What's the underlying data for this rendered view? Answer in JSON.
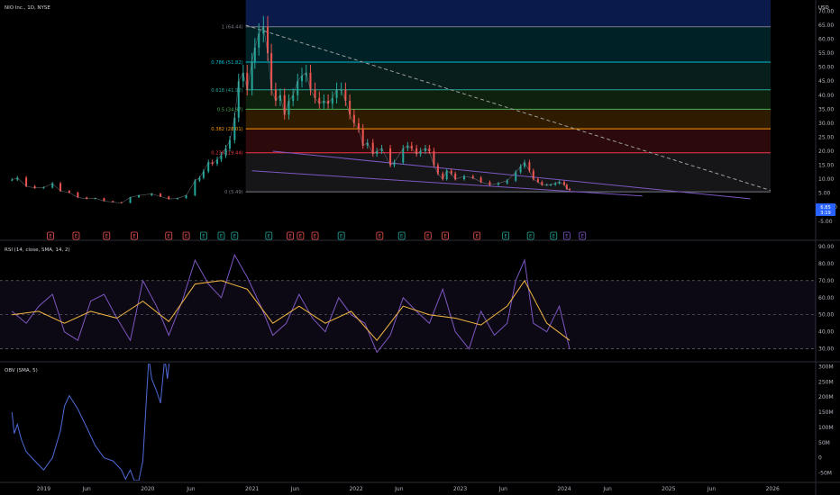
{
  "header": {
    "title": "NIO Inc., 1D, NYSE",
    "currency": "USD",
    "rsi_title": "RSI (14, close, SMA, 14, 2)",
    "obv_title": "OBV (SMA, 5)",
    "price_badge": "6.85",
    "price_badge_sub": "3:19"
  },
  "colors": {
    "background": "#000000",
    "candle_up": "#26a69a",
    "candle_down": "#ef5350",
    "trendline": "#7e57c2",
    "rsi_line": "#7e57c2",
    "rsi_ma": "#f5b942",
    "obv_line": "#4f6bd9",
    "dashed_line": "#9e9e9e",
    "badge": "#2962ff",
    "earnings_green": "#26a69a",
    "earnings_red": "#ef5350"
  },
  "chart_data": [
    {
      "type": "line",
      "panel": "price",
      "title": "NIO Inc., 1D, NYSE",
      "unit": "USD",
      "yticks": [
        -5,
        0,
        5,
        10,
        15,
        20,
        25,
        30,
        35,
        40,
        45,
        50,
        55,
        60,
        65,
        70
      ],
      "ytick_labels": [
        "-5.00",
        "0.0000",
        "5.00",
        "10.00",
        "15.00",
        "20.00",
        "25.00",
        "30.00",
        "35.00",
        "40.00",
        "45.00",
        "50.00",
        "55.00",
        "60.00",
        "65.00",
        "70.00"
      ],
      "ylim": [
        -7,
        74
      ],
      "xticks": [
        {
          "date": "2019-01-01",
          "label": "2019"
        },
        {
          "date": "2019-06-01",
          "label": "Jun"
        },
        {
          "date": "2020-01-01",
          "label": "2020"
        },
        {
          "date": "2020-06-01",
          "label": "Jun"
        },
        {
          "date": "2021-01-01",
          "label": "2021"
        },
        {
          "date": "2021-06-01",
          "label": "Jun"
        },
        {
          "date": "2022-01-01",
          "label": "2022"
        },
        {
          "date": "2022-06-01",
          "label": "Jun"
        },
        {
          "date": "2023-01-01",
          "label": "2023"
        },
        {
          "date": "2023-06-01",
          "label": "Jun"
        },
        {
          "date": "2024-01-01",
          "label": "2024"
        },
        {
          "date": "2024-06-01",
          "label": "Jun"
        },
        {
          "date": "2025-01-01",
          "label": "2025"
        },
        {
          "date": "2025-06-01",
          "label": "Jun"
        },
        {
          "date": "2026-01-01",
          "label": "2026"
        }
      ],
      "xlim": [
        "2018-08-01",
        "2026-06-01"
      ],
      "series": [
        {
          "x": [
            "2018-09-12",
            "2018-10-01",
            "2018-11-01",
            "2018-12-01",
            "2019-01-01",
            "2019-02-01",
            "2019-03-01",
            "2019-04-01",
            "2019-05-01",
            "2019-06-01",
            "2019-07-01",
            "2019-08-01",
            "2019-09-01",
            "2019-10-01",
            "2019-11-01",
            "2019-12-01",
            "2020-01-15",
            "2020-02-15",
            "2020-03-15",
            "2020-04-15",
            "2020-05-15",
            "2020-06-15",
            "2020-07-01",
            "2020-07-15",
            "2020-08-01",
            "2020-08-15",
            "2020-09-01",
            "2020-09-15",
            "2020-10-01",
            "2020-10-15",
            "2020-11-01",
            "2020-11-15",
            "2020-12-01",
            "2020-12-15",
            "2021-01-01",
            "2021-01-11",
            "2021-01-25",
            "2021-02-10",
            "2021-02-25",
            "2021-03-10",
            "2021-03-25",
            "2021-04-10",
            "2021-04-25",
            "2021-05-10",
            "2021-05-25",
            "2021-06-10",
            "2021-06-25",
            "2021-07-10",
            "2021-07-25",
            "2021-08-10",
            "2021-08-25",
            "2021-09-10",
            "2021-09-25",
            "2021-10-10",
            "2021-10-25",
            "2021-11-10",
            "2021-11-25",
            "2021-12-10",
            "2021-12-25",
            "2022-01-10",
            "2022-01-25",
            "2022-02-10",
            "2022-03-01",
            "2022-03-15",
            "2022-04-01",
            "2022-05-01",
            "2022-05-15",
            "2022-06-15",
            "2022-07-01",
            "2022-07-15",
            "2022-08-01",
            "2022-08-15",
            "2022-09-01",
            "2022-09-15",
            "2022-10-01",
            "2022-10-15",
            "2022-11-01",
            "2022-11-15",
            "2022-12-01",
            "2022-12-15",
            "2023-01-15",
            "2023-02-15",
            "2023-03-15",
            "2023-04-15",
            "2023-05-15",
            "2023-06-15",
            "2023-07-15",
            "2023-08-01",
            "2023-08-15",
            "2023-09-01",
            "2023-09-15",
            "2023-10-01",
            "2023-10-15",
            "2023-11-01",
            "2023-11-15",
            "2023-12-01",
            "2023-12-15",
            "2024-01-01",
            "2024-01-10",
            "2024-01-20"
          ],
          "values": [
            9.8,
            10.5,
            7.5,
            6.9,
            7.0,
            8.5,
            5.8,
            5.2,
            3.5,
            3.0,
            3.2,
            2.2,
            1.8,
            1.5,
            3.5,
            4.2,
            4.8,
            3.8,
            2.9,
            3.2,
            4.2,
            9.5,
            10.5,
            12.8,
            16.0,
            15.5,
            17.0,
            18.5,
            21.0,
            24.0,
            32.0,
            45.0,
            48.0,
            42.0,
            52.0,
            57.0,
            62.0,
            64.44,
            55.0,
            42.0,
            38.0,
            40.0,
            33.0,
            38.0,
            40.0,
            45.0,
            47.0,
            48.0,
            42.0,
            39.0,
            37.0,
            38.0,
            37.0,
            39.0,
            42.0,
            42.0,
            38.0,
            33.0,
            30.0,
            28.0,
            22.0,
            23.0,
            19.0,
            20.0,
            21.0,
            15.0,
            16.0,
            21.0,
            22.0,
            21.0,
            19.0,
            20.0,
            21.0,
            20.0,
            15.0,
            12.0,
            10.0,
            13.0,
            12.0,
            10.0,
            11.0,
            10.5,
            9.0,
            8.0,
            8.5,
            9.5,
            12.5,
            14.5,
            16.0,
            13.0,
            10.0,
            9.0,
            8.0,
            8.0,
            8.0,
            8.5,
            9.0,
            8.0,
            6.5,
            6.2
          ]
        }
      ],
      "fibonacci": [
        {
          "ratio": "1",
          "price": 64.44,
          "label": "1 (64.44)",
          "color": "#787b86"
        },
        {
          "ratio": "0.786",
          "price": 51.82,
          "label": "0.786 (51.82)",
          "color": "#00bcd4"
        },
        {
          "ratio": "0.618",
          "price": 41.92,
          "label": "0.618 (41.92)",
          "color": "#26a69a"
        },
        {
          "ratio": "0.5",
          "price": 34.97,
          "label": "0.5 (34.97)",
          "color": "#4caf50"
        },
        {
          "ratio": "0.382",
          "price": 28.01,
          "label": "0.382 (28.01)",
          "color": "#ff9800"
        },
        {
          "ratio": "0.236",
          "price": 19.44,
          "label": "0.236 (19.44)",
          "color": "#f23645"
        },
        {
          "ratio": "0",
          "price": 5.49,
          "label": "0 (5.49)",
          "color": "#787b86"
        }
      ],
      "fib_box": {
        "start": "2020-12-10",
        "end": "2025-12-25",
        "above_color": "#0a1a4a"
      },
      "trendlines": [
        {
          "style": "dashed",
          "color": "#9e9e9e",
          "from": {
            "x": "2020-12-10",
            "y": 65.0
          },
          "to": {
            "x": "2025-12-25",
            "y": 6.0
          }
        },
        {
          "style": "solid",
          "color": "#7e57c2",
          "from": {
            "x": "2021-03-15",
            "y": 20.0
          },
          "to": {
            "x": "2025-10-15",
            "y": 3.0
          }
        },
        {
          "style": "solid",
          "color": "#7e57c2",
          "from": {
            "x": "2021-01-01",
            "y": 13.0
          },
          "to": {
            "x": "2024-10-01",
            "y": 4.0
          }
        }
      ],
      "earnings_markers": [
        {
          "x": "2019-01-25",
          "label": "E",
          "kind": "red"
        },
        {
          "x": "2019-04-25",
          "label": "E",
          "kind": "red"
        },
        {
          "x": "2019-08-10",
          "label": "E",
          "kind": "red"
        },
        {
          "x": "2019-11-15",
          "label": "E",
          "kind": "red"
        },
        {
          "x": "2020-03-15",
          "label": "E",
          "kind": "red"
        },
        {
          "x": "2020-05-15",
          "label": "E",
          "kind": "red"
        },
        {
          "x": "2020-07-15",
          "label": "E",
          "kind": "green"
        },
        {
          "x": "2020-09-15",
          "label": "E",
          "kind": "green"
        },
        {
          "x": "2020-11-01",
          "label": "E",
          "kind": "green"
        },
        {
          "x": "2021-03-01",
          "label": "E",
          "kind": "green"
        },
        {
          "x": "2021-05-15",
          "label": "E",
          "kind": "red"
        },
        {
          "x": "2021-06-20",
          "label": "E",
          "kind": "red"
        },
        {
          "x": "2021-08-10",
          "label": "E",
          "kind": "red"
        },
        {
          "x": "2021-11-10",
          "label": "E",
          "kind": "green"
        },
        {
          "x": "2022-03-25",
          "label": "E",
          "kind": "red"
        },
        {
          "x": "2022-06-10",
          "label": "E",
          "kind": "green"
        },
        {
          "x": "2022-09-10",
          "label": "E",
          "kind": "red"
        },
        {
          "x": "2022-11-10",
          "label": "E",
          "kind": "red"
        },
        {
          "x": "2023-03-01",
          "label": "E",
          "kind": "red"
        },
        {
          "x": "2023-06-10",
          "label": "E",
          "kind": "green"
        },
        {
          "x": "2023-09-05",
          "label": "E",
          "kind": "green"
        },
        {
          "x": "2023-11-25",
          "label": "E",
          "kind": "green"
        },
        {
          "x": "2024-01-10",
          "label": "E",
          "kind": "purple"
        },
        {
          "x": "2024-03-05",
          "label": "E",
          "kind": "purple"
        }
      ]
    },
    {
      "type": "line",
      "panel": "rsi",
      "title": "RSI (14, close, SMA, 14, 2)",
      "yticks": [
        30,
        40,
        50,
        60,
        70,
        80,
        90
      ],
      "ytick_labels": [
        "30.00",
        "40.00",
        "50.00",
        "60.00",
        "70.00",
        "80.00",
        "90.00"
      ],
      "ylim": [
        23,
        92
      ],
      "bands": [
        30,
        50,
        70
      ],
      "series": [
        {
          "name": "RSI",
          "x": [
            "2018-09-12",
            "2018-11-01",
            "2018-12-15",
            "2019-02-01",
            "2019-03-15",
            "2019-05-01",
            "2019-06-15",
            "2019-08-01",
            "2019-09-15",
            "2019-11-01",
            "2019-12-15",
            "2020-02-01",
            "2020-03-15",
            "2020-05-01",
            "2020-06-15",
            "2020-08-01",
            "2020-09-15",
            "2020-11-01",
            "2020-12-15",
            "2021-02-01",
            "2021-03-15",
            "2021-05-01",
            "2021-06-15",
            "2021-08-01",
            "2021-09-15",
            "2021-11-01",
            "2021-12-15",
            "2022-02-01",
            "2022-03-15",
            "2022-05-01",
            "2022-06-15",
            "2022-08-01",
            "2022-09-15",
            "2022-11-01",
            "2022-12-15",
            "2023-02-01",
            "2023-03-15",
            "2023-05-01",
            "2023-06-15",
            "2023-07-15",
            "2023-08-15",
            "2023-09-15",
            "2023-11-01",
            "2023-12-15",
            "2024-01-20"
          ],
          "values": [
            52,
            45,
            55,
            62,
            40,
            35,
            58,
            62,
            48,
            35,
            70,
            55,
            38,
            58,
            82,
            68,
            60,
            85,
            72,
            55,
            38,
            45,
            62,
            48,
            40,
            60,
            50,
            45,
            28,
            38,
            60,
            52,
            45,
            65,
            40,
            30,
            52,
            38,
            45,
            70,
            82,
            45,
            40,
            55,
            30
          ]
        },
        {
          "name": "RSI-based MA",
          "x": [
            "2018-09-12",
            "2018-12-15",
            "2019-03-15",
            "2019-06-15",
            "2019-09-15",
            "2019-12-15",
            "2020-03-15",
            "2020-06-15",
            "2020-09-15",
            "2020-12-15",
            "2021-03-15",
            "2021-06-15",
            "2021-09-15",
            "2021-12-15",
            "2022-03-15",
            "2022-06-15",
            "2022-09-15",
            "2022-12-15",
            "2023-03-15",
            "2023-06-15",
            "2023-08-15",
            "2023-11-01",
            "2024-01-20"
          ],
          "values": [
            50,
            52,
            45,
            52,
            48,
            58,
            46,
            68,
            70,
            65,
            45,
            55,
            45,
            52,
            35,
            55,
            50,
            48,
            44,
            55,
            70,
            45,
            35
          ]
        }
      ]
    },
    {
      "type": "line",
      "panel": "obv",
      "title": "OBV (SMA, 5)",
      "yticks": [
        -50,
        0,
        50,
        100,
        150,
        200,
        250,
        300
      ],
      "ytick_labels": [
        "-50M",
        "0",
        "50M",
        "100M",
        "150M",
        "200M",
        "250M",
        "300M"
      ],
      "ylim": [
        -75,
        310
      ],
      "series": [
        {
          "name": "OBV",
          "x": [
            "2018-09-12",
            "2018-09-20",
            "2018-10-01",
            "2018-10-15",
            "2018-11-01",
            "2018-12-01",
            "2019-01-01",
            "2019-02-01",
            "2019-03-01",
            "2019-03-15",
            "2019-04-01",
            "2019-05-01",
            "2019-06-01",
            "2019-07-01",
            "2019-08-01",
            "2019-09-01",
            "2019-10-01",
            "2019-10-15",
            "2019-11-01",
            "2019-11-15",
            "2019-12-01",
            "2019-12-15",
            "2019-12-25",
            "2020-01-05",
            "2020-01-15",
            "2020-02-01",
            "2020-02-15",
            "2020-03-01",
            "2020-03-10",
            "2020-03-20",
            "2020-04-01"
          ],
          "values": [
            150,
            80,
            110,
            60,
            20,
            -10,
            -40,
            0,
            90,
            170,
            205,
            160,
            100,
            40,
            0,
            -10,
            -40,
            -70,
            -40,
            -75,
            -75,
            -10,
            150,
            330,
            260,
            220,
            180,
            330,
            260,
            340,
            380
          ]
        }
      ]
    }
  ]
}
